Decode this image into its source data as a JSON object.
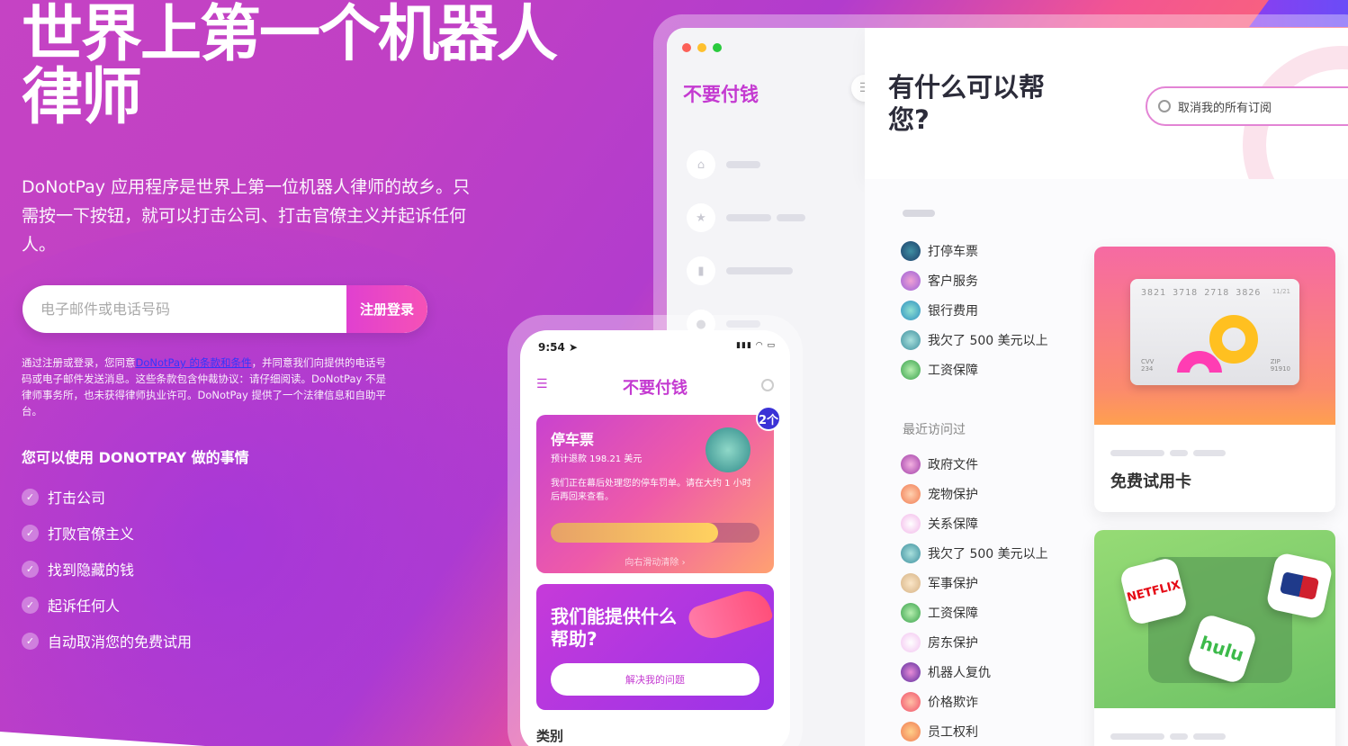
{
  "hero": {
    "title": "世界上第一个机器人律师",
    "lead": "DoNotPay 应用程序是世界上第一位机器人律师的故乡。只需按一下按钮，就可以打击公司、打击官僚主义并起诉任何人。",
    "input_placeholder": "电子邮件或电话号码",
    "signup_button": "注册登录",
    "terms_pre": "通过注册或登录，您同意",
    "terms_link": "DoNotPay 的条款和条件",
    "terms_post": "，并同意我们向提供的电话号码或电子邮件发送消息。这些条款包含仲裁协议：请仔细阅读。DoNotPay 不是律师事务所，也未获得律师执业许可。DoNotPay 提供了一个法律信息和自助平台。",
    "can_heading": "您可以使用 DONOTPAY 做的事情",
    "features": [
      "打击公司",
      "打败官僚主义",
      "找到隐藏的钱",
      "起诉任何人",
      "自动取消您的免费试用"
    ]
  },
  "desktop": {
    "brand": "不要付钱",
    "question": "有什么可以帮您?",
    "search_placeholder": "取消我的所有订阅",
    "categories": [
      "打停车票",
      "客户服务",
      "银行费用",
      "我欠了 500 美元以上",
      "工资保障"
    ],
    "recent_label": "最近访问过",
    "recent": [
      "政府文件",
      "宠物保护",
      "关系保障",
      "我欠了 500 美元以上",
      "军事保护",
      "工资保障",
      "房东保护",
      "机器人复仇",
      "价格欺诈",
      "员工权利"
    ],
    "card1_title": "免费试用卡",
    "card_number": "3821 3718 2718 3826",
    "card_exp": "11/21",
    "card_cvv_label": "CVV",
    "card_cvv": "234",
    "card_zip_label": "ZIP",
    "card_zip": "91910",
    "card2_logos": [
      "NETFLIX",
      "hulu"
    ],
    "colors": {
      "accent": "#c43ad1",
      "search_border": "#e384d5"
    }
  },
  "phone": {
    "time": "9:54",
    "brand": "不要付钱",
    "badge": "2个",
    "park_title": "停车票",
    "park_sub": "预计退款 198.21 美元",
    "park_desc": "我们正在幕后处理您的停车罚单。请在大约 1 小时后再回来查看。",
    "progress": 0.8,
    "swipe": "向右滑动清除 ›",
    "help_title": "我们能提供什么帮助?",
    "help_button": "解决我的问题",
    "categories_label": "类别"
  }
}
